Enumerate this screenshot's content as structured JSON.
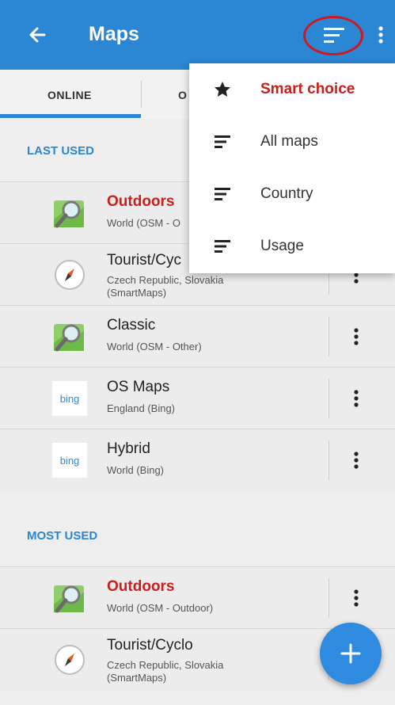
{
  "appbar": {
    "title": "Maps"
  },
  "tabs": {
    "online": "ONLINE",
    "offline": "O"
  },
  "sections": {
    "last_used": "LAST USED",
    "most_used": "MOST USED"
  },
  "last_used": [
    {
      "title": "Outdoors",
      "subtitle": "World (OSM - O",
      "icon": "map-magnifier-icon",
      "highlight": true
    },
    {
      "title": "Tourist/Cyc",
      "subtitle": "Czech Republic, Slovakia (SmartMaps)",
      "icon": "compass-icon",
      "highlight": false
    },
    {
      "title": "Classic",
      "subtitle": "World (OSM - Other)",
      "icon": "map-magnifier-icon",
      "highlight": false
    },
    {
      "title": "OS Maps",
      "subtitle": "England (Bing)",
      "icon": "bing-logo",
      "highlight": false
    },
    {
      "title": "Hybrid",
      "subtitle": "World (Bing)",
      "icon": "bing-logo",
      "highlight": false
    }
  ],
  "most_used": [
    {
      "title": "Outdoors",
      "subtitle": "World (OSM - Outdoor)",
      "icon": "map-magnifier-icon",
      "highlight": true
    },
    {
      "title": "Tourist/Cyclo",
      "subtitle": "Czech Republic, Slovakia (SmartMaps)",
      "icon": "compass-icon",
      "highlight": false
    }
  ],
  "bing_logo_text": "bing",
  "sort_menu": {
    "items": [
      {
        "label": "Smart choice",
        "icon": "star-icon",
        "active": true
      },
      {
        "label": "All maps",
        "icon": "sort-lines-icon",
        "active": false
      },
      {
        "label": "Country",
        "icon": "sort-lines-icon",
        "active": false
      },
      {
        "label": "Usage",
        "icon": "sort-lines-icon",
        "active": false
      }
    ]
  },
  "colors": {
    "primary": "#2b86d4",
    "accent_red": "#cc1d1d",
    "highlight_circle": "#d0191f"
  }
}
